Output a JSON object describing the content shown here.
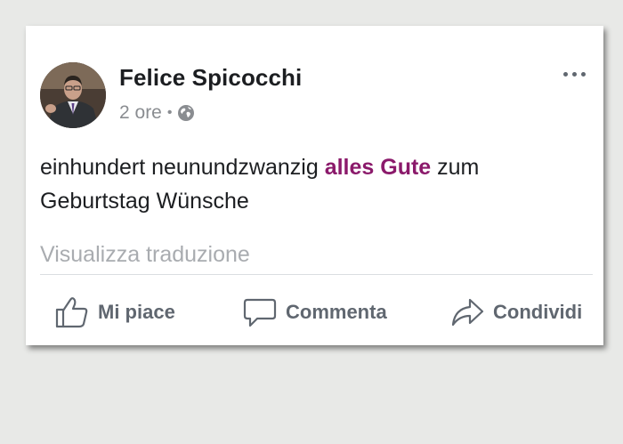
{
  "post": {
    "author": "Felice Spicocchi",
    "time": "2 ore",
    "separator": "•",
    "audience_icon": "globe-icon",
    "text_before": "einhundert neunundzwanzig ",
    "text_highlight": "alles Gute",
    "text_after": " zum Geburtstag Wünsche",
    "highlight_color": "#8b1a6b",
    "translate_link": "Visualizza traduzione"
  },
  "actions": {
    "like": "Mi piace",
    "comment": "Commenta",
    "share": "Condividi"
  }
}
